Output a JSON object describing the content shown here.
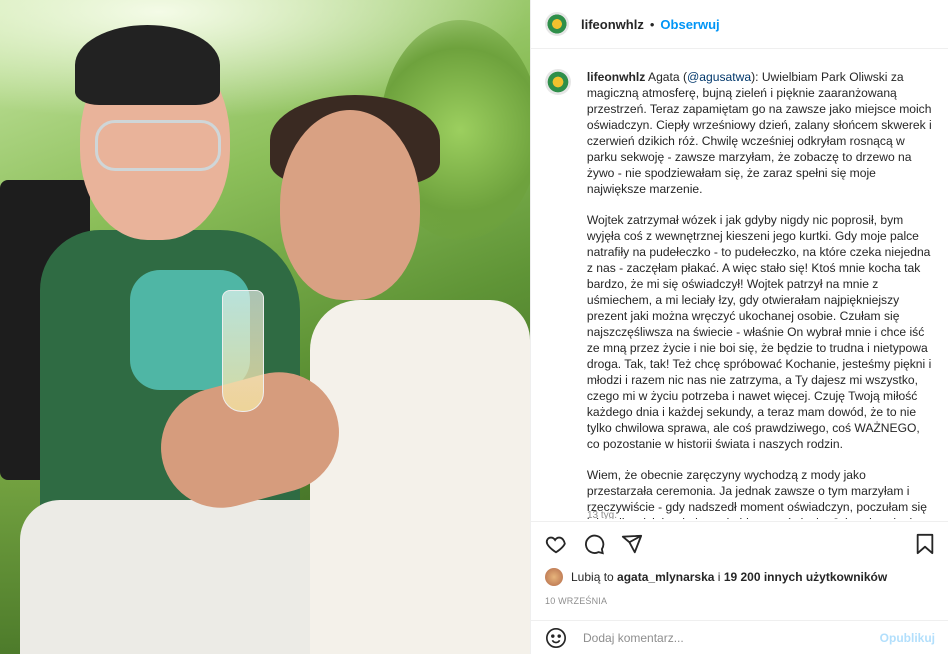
{
  "post": {
    "username": "lifeonwhlz",
    "separator": "•",
    "follow_label": "Obserwuj",
    "more_icon": "more-horizontal-icon"
  },
  "caption": {
    "username": "lifeonwhlz",
    "intro": "Agata (",
    "mention": "@agusatwa",
    "para1_rest": "): Uwielbiam Park Oliwski za magiczną atmosferę, bujną zieleń i pięknie zaaranżowaną przestrzeń. Teraz zapamiętam go na zawsze jako miejsce moich oświadczyn. Ciepły wrześniowy dzień, zalany słońcem skwerek i czerwień dzikich róż. Chwilę wcześniej odkryłam rosnącą w parku sekwoję - zawsze marzyłam, że zobaczę to drzewo na żywo - nie spodziewałam się, że zaraz spełni się moje największe marzenie.",
    "para2": "Wojtek zatrzymał wózek i jak gdyby nigdy nic poprosił, bym wyjęła coś z wewnętrznej kieszeni jego kurtki. Gdy moje palce natrafiły na pudełeczko - to pudełeczko, na które czeka niejedna z nas - zaczęłam płakać. A więc stało się! Ktoś mnie kocha tak bardzo, że mi się oświadczył! Wojtek patrzył na mnie z uśmiechem, a mi leciały łzy, gdy otwierałam najpiękniejszy prezent jaki można wręczyć ukochanej osobie. Czułam się najszczęśliwsza na świecie - właśnie On wybrał mnie i chce iść ze mną przez życie i nie boi się, że będzie to trudna i nietypowa droga. Tak, tak! Też chcę spróbować Kochanie, jesteśmy piękni i młodzi i razem nic nas nie zatrzyma, a Ty dajesz mi wszystko, czego mi w życiu potrzeba i nawet więcej. Czuję Twoją miłość każdego dnia i każdej sekundy, a teraz mam dowód, że to nie tylko chwilowa sprawa, ale coś prawdziwego, coś WAŻNEGO, co pozostanie w historii świata i naszych rodzin.",
    "para3": "Wiem, że obecnie zaręczyny wychodzą z mody jako przestarzała ceremonia. Ja jednak zawsze o tym marzyłam i rzeczywiście - gdy nadszedł moment oświadczyn, poczułam się jak najbardziej wyjątkowa kobieta na świecie. Jak wybranka jego serca. Jak szczęśliwa narzeczona.",
    "time_ago": "13 tyg."
  },
  "actions": {
    "like_icon": "heart-icon",
    "comment_icon": "comment-icon",
    "share_icon": "share-icon",
    "save_icon": "bookmark-icon"
  },
  "likes": {
    "prefix": "Lubią to",
    "user": "agata_mlynarska",
    "middle": "i",
    "others": "19 200 innych użytkowników"
  },
  "date": "10 WRZEŚNIA",
  "comment": {
    "placeholder": "Dodaj komentarz...",
    "publish_label": "Opublikuj",
    "emoji_icon": "smiley-icon"
  }
}
